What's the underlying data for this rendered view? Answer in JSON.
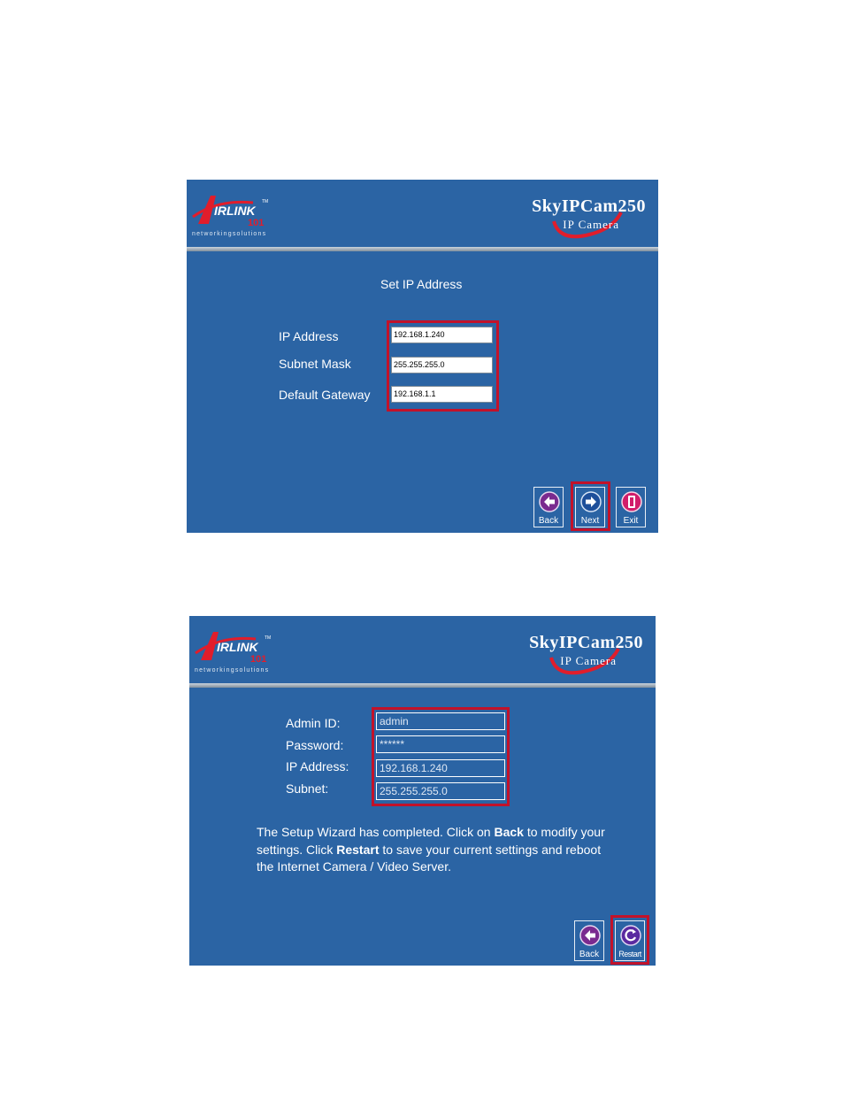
{
  "logo": {
    "brand": "AIRLINK",
    "number": "101",
    "tm": "TM",
    "subtitle": "networkingsolutions"
  },
  "product": {
    "title": "SkyIPCam250",
    "subtitle": "IP Camera"
  },
  "screen1": {
    "heading": "Set IP Address",
    "fields": [
      {
        "label": "IP Address",
        "value": "192.168.1.240"
      },
      {
        "label": "Subnet Mask",
        "value": "255.255.255.0"
      },
      {
        "label": "Default Gateway",
        "value": "192.168.1.1"
      }
    ],
    "buttons": {
      "back": "Back",
      "next": "Next",
      "exit": "Exit"
    }
  },
  "screen2": {
    "fields": [
      {
        "label": "Admin ID:",
        "value": "admin"
      },
      {
        "label": "Password:",
        "value": "******"
      },
      {
        "label": "IP Address:",
        "value": "192.168.1.240"
      },
      {
        "label": "Subnet:",
        "value": "255.255.255.0"
      }
    ],
    "message": {
      "part1": "The Setup Wizard has completed. Click on ",
      "back_word": "Back",
      "part2": " to modify your settings. Click ",
      "restart_word": "Restart",
      "part3": " to save your current settings and reboot the Internet Camera / Video Server."
    },
    "buttons": {
      "back": "Back",
      "restart": "Restart"
    }
  },
  "colors": {
    "panel_bg": "#2b64a4",
    "highlight": "#c2122a",
    "text": "#ffffff"
  },
  "icons": {
    "back": "left-arrow-icon",
    "next": "right-arrow-icon",
    "exit": "exit-door-icon",
    "restart": "restart-icon"
  }
}
